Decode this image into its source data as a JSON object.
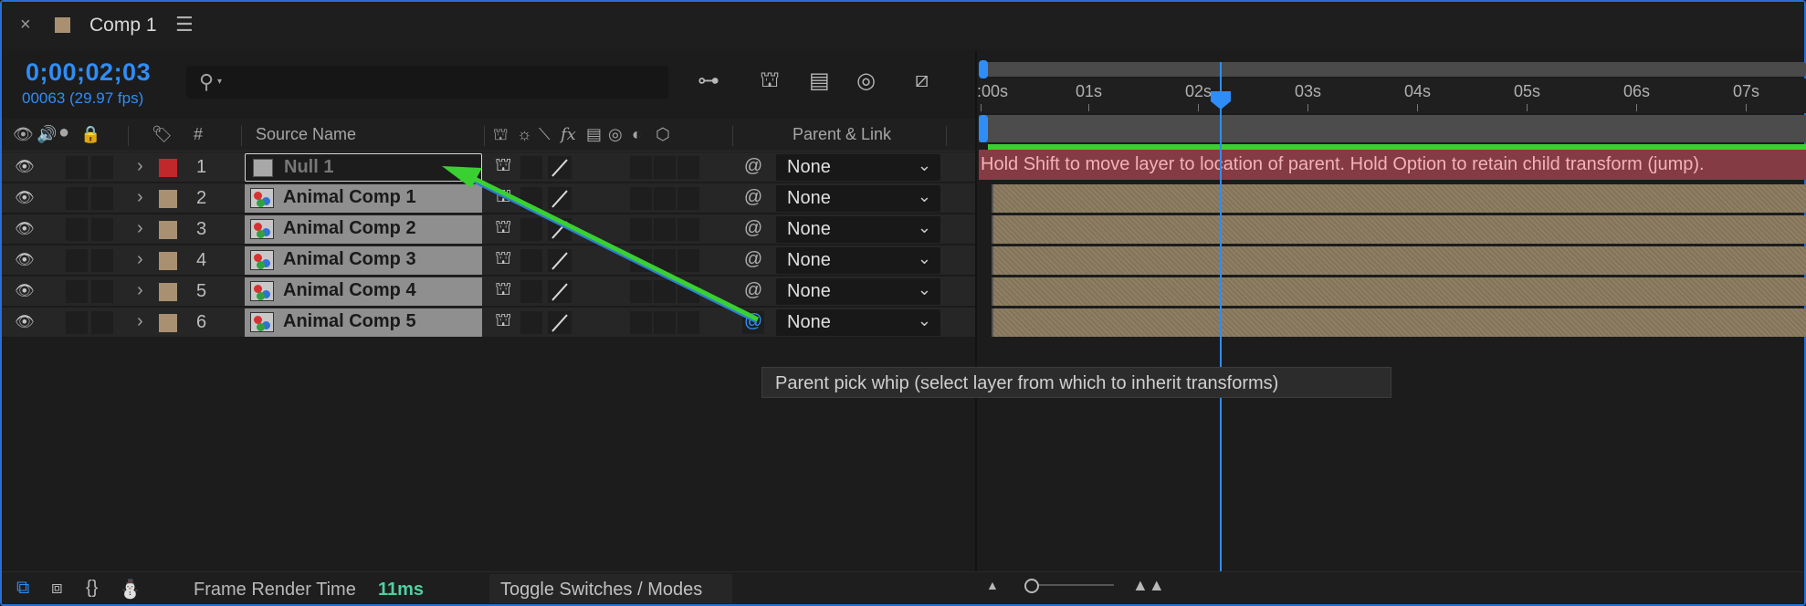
{
  "tab": {
    "close": "×",
    "title": "Comp 1",
    "menu": "☰"
  },
  "header": {
    "timecode": "0;00;02;03",
    "frame_info": "00063 (29.97 fps)",
    "search_placeholder": ""
  },
  "columns": {
    "num": "#",
    "source_name": "Source Name",
    "parent_link": "Parent & Link"
  },
  "layers": [
    {
      "num": "1",
      "name": "Null 1",
      "label_color": "#c0282c",
      "type": "null",
      "parent": "None",
      "selected": true
    },
    {
      "num": "2",
      "name": "Animal Comp 1",
      "label_color": "#a89070",
      "type": "comp",
      "parent": "None"
    },
    {
      "num": "3",
      "name": "Animal Comp 2",
      "label_color": "#a89070",
      "type": "comp",
      "parent": "None"
    },
    {
      "num": "4",
      "name": "Animal Comp 3",
      "label_color": "#a89070",
      "type": "comp",
      "parent": "None"
    },
    {
      "num": "5",
      "name": "Animal Comp 4",
      "label_color": "#a89070",
      "type": "comp",
      "parent": "None"
    },
    {
      "num": "6",
      "name": "Animal Comp 5",
      "label_color": "#a89070",
      "type": "comp",
      "parent": "None"
    }
  ],
  "timeline": {
    "ticks": [
      ":00s",
      "01s",
      "02s",
      "03s",
      "04s",
      "05s",
      "06s",
      "07s"
    ],
    "hint": "Hold Shift to move layer to location of parent. Hold Option to retain child transform (jump).",
    "tooltip": "Parent pick whip (select layer from which to inherit transforms)"
  },
  "footer": {
    "frame_render_label": "Frame Render Time",
    "frame_render_value": "11ms",
    "toggle_label": "Toggle Switches / Modes"
  },
  "colors": {
    "accent": "#2f8df7",
    "arrow": "#3ad032",
    "hint_bg": "#843b43",
    "bar": "#8a7a5e"
  }
}
